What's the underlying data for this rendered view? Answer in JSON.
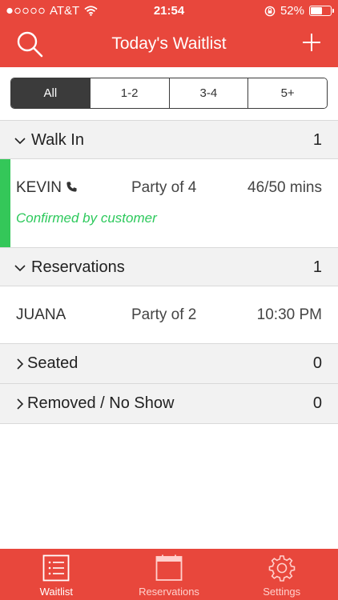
{
  "status_bar": {
    "carrier": "AT&T",
    "time": "21:54",
    "battery": "52%",
    "battery_level": 0.52
  },
  "header": {
    "title": "Today's Waitlist",
    "left_icon": "search-icon",
    "right_icon": "plus-icon"
  },
  "filter": {
    "selected": "All",
    "options": [
      "All",
      "1-2",
      "3-4",
      "5+"
    ]
  },
  "sections": {
    "walk_in": {
      "title": "Walk In",
      "count": "1",
      "expanded": true,
      "entries": [
        {
          "name": "KEVIN",
          "party": "Party of 4",
          "time": "46/50 mins",
          "status": "Confirmed by customer"
        }
      ]
    },
    "reservations": {
      "title": "Reservations",
      "count": "1",
      "expanded": true,
      "entries": [
        {
          "name": "JUANA",
          "party": "Party of 2",
          "time": "10:30 PM"
        }
      ]
    },
    "seated": {
      "title": "Seated",
      "count": "0",
      "expanded": false
    },
    "removed": {
      "title": "Removed / No Show",
      "count": "0",
      "expanded": false
    }
  },
  "tabs": [
    {
      "label": "Waitlist",
      "icon": "list-icon",
      "active": true
    },
    {
      "label": "Reservations",
      "icon": "calendar-icon",
      "active": false
    },
    {
      "label": "Settings",
      "icon": "gear-icon",
      "active": false
    }
  ],
  "colors": {
    "brand": "#e8473c",
    "confirmed": "#2dc95c",
    "segment_dark": "#3b3b3b"
  }
}
